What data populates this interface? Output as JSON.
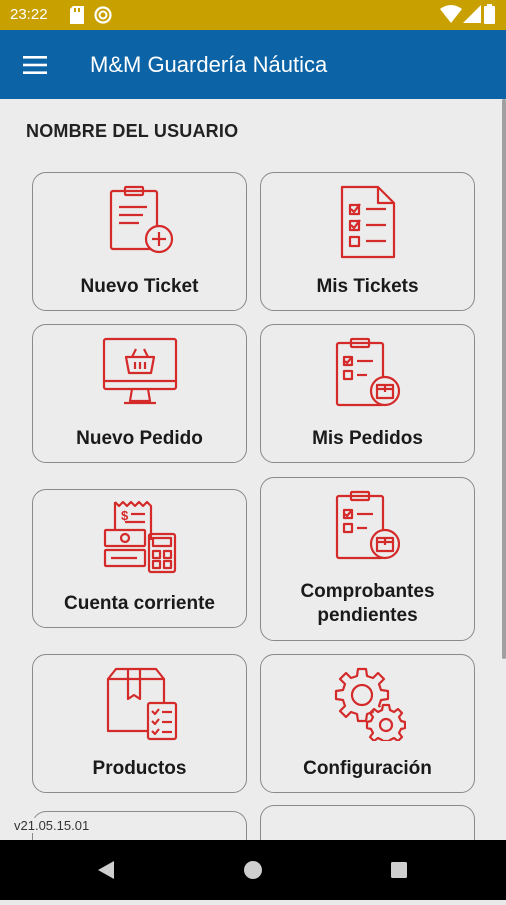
{
  "status_bar": {
    "time": "23:22",
    "icons": [
      "sd-card-icon",
      "do-not-disturb-icon",
      "wifi-icon",
      "signal-icon",
      "battery-icon"
    ]
  },
  "app_bar": {
    "title": "M&M Guardería Náutica",
    "menu_icon": "hamburger-menu-icon",
    "color": "#0c64a6"
  },
  "user": {
    "name": "NOMBRE DEL USUARIO"
  },
  "tiles": [
    {
      "label": "Nuevo Ticket",
      "icon": "clipboard-plus-icon"
    },
    {
      "label": "Mis Tickets",
      "icon": "checklist-icon"
    },
    {
      "label": "Nuevo Pedido",
      "icon": "monitor-basket-icon"
    },
    {
      "label": "Mis Pedidos",
      "icon": "clipboard-box-icon"
    },
    {
      "label": "Cuenta corriente",
      "icon": "receipt-calculator-icon"
    },
    {
      "label": "Comprobantes pendientes",
      "label_line1": "Comprobantes",
      "label_line2": "pendientes",
      "icon": "clipboard-box-icon"
    },
    {
      "label": "Productos",
      "icon": "box-checklist-icon"
    },
    {
      "label": "Configuración",
      "icon": "gears-icon"
    }
  ],
  "accent_color": "#d42a2a",
  "version": "v21.05.15.01",
  "nav_bar": {
    "buttons": [
      "back-icon",
      "home-icon",
      "recents-icon"
    ]
  }
}
